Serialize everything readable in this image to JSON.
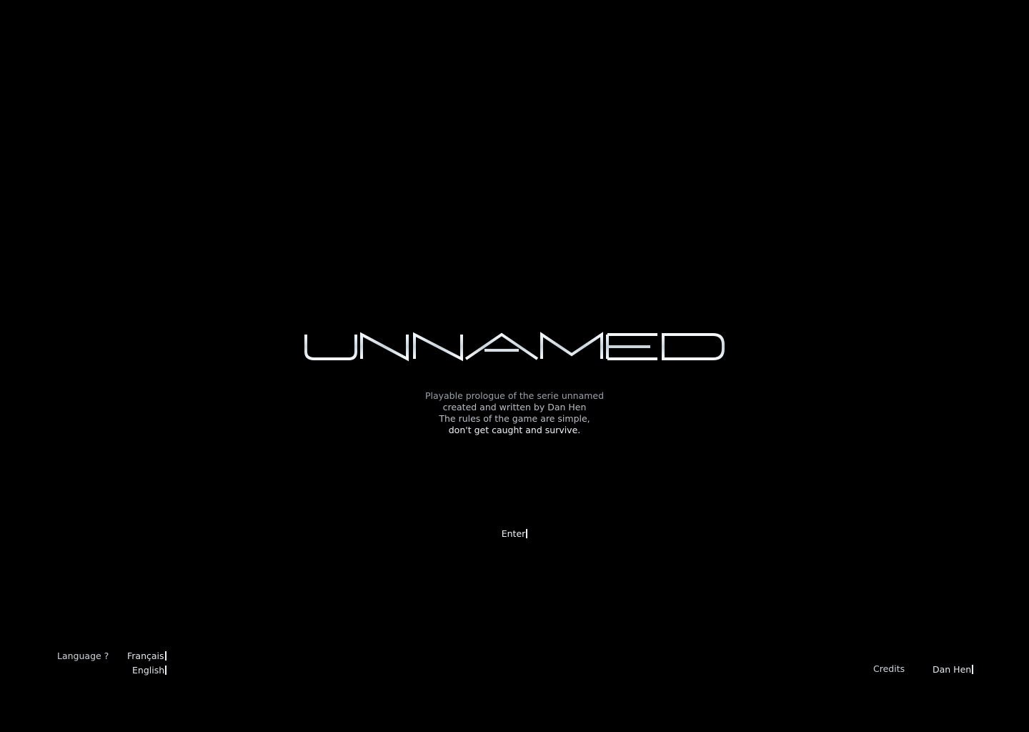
{
  "title": {
    "logo_text": "UNNAMED"
  },
  "intro": {
    "line1": "Playable prologue of the serie unnamed",
    "line2": "created and written by Dan Hen",
    "line3": "The rules of the game are simple,",
    "line4": "don't get caught and survive."
  },
  "enter_label": "Enter",
  "language": {
    "label": "Language ?",
    "options": [
      "Français",
      "English"
    ]
  },
  "credits": {
    "label": "Credits",
    "name": "Dan Hen"
  },
  "colors": {
    "background": "#000000",
    "text": "#d8dde2",
    "logo": "#eaf1f5"
  }
}
